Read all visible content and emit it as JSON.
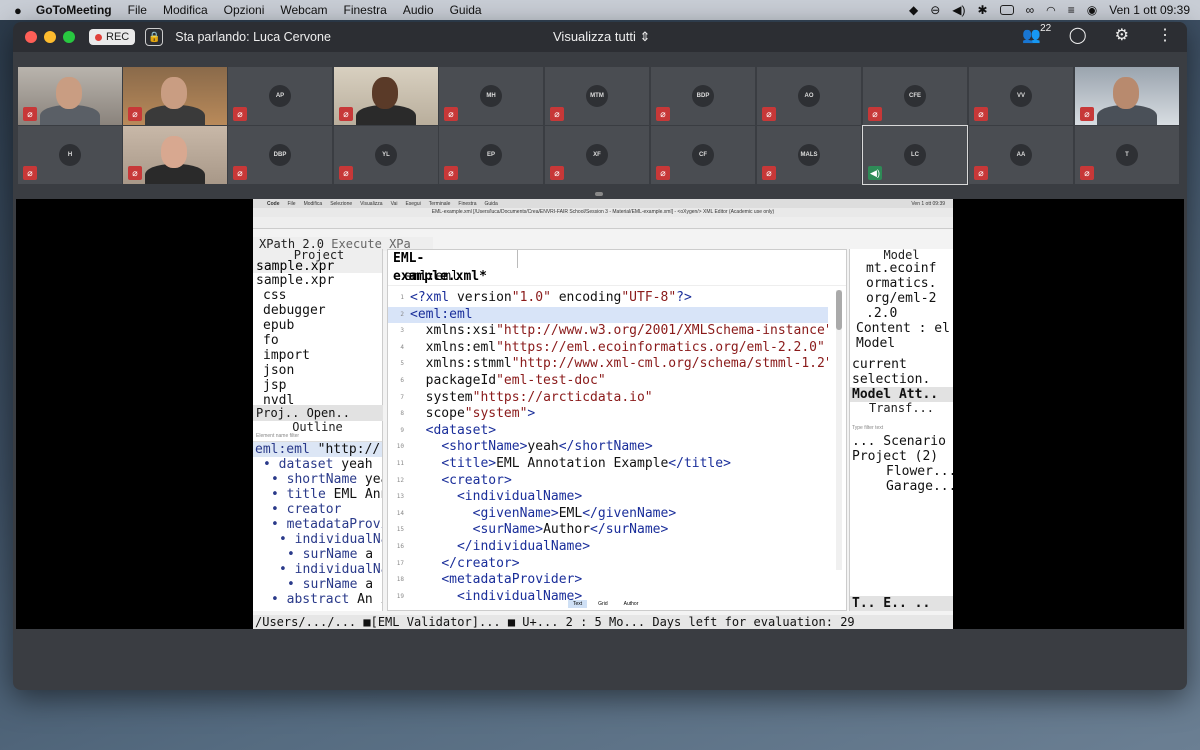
{
  "menubar": {
    "apple": "",
    "app_name": "GoToMeeting",
    "items": [
      "File",
      "Modifica",
      "Opzioni",
      "Webcam",
      "Finestra",
      "Audio",
      "Guida"
    ],
    "clock": "Ven 1 ott  09:39"
  },
  "titlebar": {
    "rec_label": "REC",
    "speaking_label": "Sta parlando: Luca Cervone",
    "view_all_label": "Visualizza tutti",
    "participant_count": "22",
    "colors": {
      "close": "#ff5f57",
      "minimize": "#febc2e",
      "maximize": "#28c840"
    }
  },
  "participants": {
    "row1": [
      "",
      "",
      "AP",
      "",
      "MH",
      "MTM",
      "BDP",
      "AO",
      "CFE",
      "VV",
      ""
    ],
    "row2": [
      "H",
      "",
      "DBP",
      "YL",
      "EP",
      "XF",
      "CF",
      "MALS",
      "LC",
      "AA",
      "T"
    ]
  },
  "shared_screen": {
    "inner_menubar": [
      "Code",
      "File",
      "Modifica",
      "Selezione",
      "Visualizza",
      "Vai",
      "Esegui",
      "Terminale",
      "Finestra",
      "Guida"
    ],
    "inner_clock": "Ven 1 ott  09:39",
    "window_title": "EML-example.xml [/Users/luca/Documents/Crea/ENVRI-FAIR School/Session 3 - Material/EML-example.xml] - <oXygen/> XML Editor (Academic use only)",
    "xpath_label": "XPath 2.0",
    "xpath_extra": "Execute XPa",
    "project": {
      "title": "Project",
      "file": "sample.xpr",
      "root": "sample.xpr",
      "folders": [
        "css",
        "debugger",
        "epub",
        "fo",
        "import",
        "json",
        "jsp",
        "nvdl"
      ]
    },
    "left_tabs": "Proj..  Open..",
    "outline": {
      "title": "Outline",
      "filter_placeholder": "Element name filter",
      "items": [
        {
          "indent": 0,
          "name": "eml:eml",
          "val": "\"http://"
        },
        {
          "indent": 1,
          "name": "dataset",
          "val": "yeah"
        },
        {
          "indent": 2,
          "name": "shortName",
          "val": "yea"
        },
        {
          "indent": 2,
          "name": "title",
          "val": "EML Ann"
        },
        {
          "indent": 2,
          "name": "creator",
          "val": ""
        },
        {
          "indent": 2,
          "name": "metadataProvi",
          "val": ""
        },
        {
          "indent": 3,
          "name": "individualNa",
          "val": ""
        },
        {
          "indent": 4,
          "name": "surName",
          "val": "a"
        },
        {
          "indent": 3,
          "name": "individualNa",
          "val": ""
        },
        {
          "indent": 4,
          "name": "surName",
          "val": "a"
        },
        {
          "indent": 2,
          "name": "abstract",
          "val": "An i"
        }
      ]
    },
    "editor": {
      "tab": "EML-example.xml*",
      "breadcrumb": "eml:eml",
      "lines": [
        {
          "n": "1",
          "t": "<?xml version=\"1.0\" encoding=\"UTF-8\"?>"
        },
        {
          "n": "2",
          "t": "<eml:eml"
        },
        {
          "n": "3",
          "t": "  xmlns:xsi=\"http://www.w3.org/2001/XMLSchema-instance\""
        },
        {
          "n": "4",
          "t": "  xmlns:eml=\"https://eml.ecoinformatics.org/eml-2.2.0\""
        },
        {
          "n": "5",
          "t": "  xmlns:stmml=\"http://www.xml-cml.org/schema/stmml-1.2\""
        },
        {
          "n": "6",
          "t": "  packageId=\"eml-test-doc\""
        },
        {
          "n": "7",
          "t": "  system=\"https://arcticdata.io\""
        },
        {
          "n": "8",
          "t": "  scope=\"system\">"
        },
        {
          "n": "9",
          "t": "  <dataset>"
        },
        {
          "n": "10",
          "t": "    <shortName>yeah</shortName>"
        },
        {
          "n": "11",
          "t": "    <title>EML Annotation Example</title>"
        },
        {
          "n": "12",
          "t": "    <creator>"
        },
        {
          "n": "13",
          "t": "      <individualName>"
        },
        {
          "n": "14",
          "t": "        <givenName>EML</givenName>"
        },
        {
          "n": "15",
          "t": "        <surName>Author</surName>"
        },
        {
          "n": "16",
          "t": "      </individualName>"
        },
        {
          "n": "17",
          "t": "    </creator>"
        },
        {
          "n": "18",
          "t": "    <metadataProvider>"
        },
        {
          "n": "19",
          "t": "      <individualName>"
        }
      ],
      "bottom_tabs": [
        "Text",
        "Grid",
        "Author"
      ]
    },
    "right_pane": {
      "model_title": "Model",
      "model_lines": [
        "mt.ecoinf",
        "ormatics.",
        "org/eml-2",
        ".2.0",
        "Content : el",
        "Model"
      ],
      "selection_lines": [
        "current",
        "selection."
      ],
      "tabs1": "Model  Att..",
      "transform_title": "Transf...",
      "filter_placeholder": "Type filter text",
      "scenario_header": "... Scenario",
      "project_label": "Project (2)",
      "scenarios": [
        "Flower...",
        "Garage..."
      ],
      "tabs2": "T..  E..  .."
    },
    "status_bar": "/Users/.../...  ■[EML Validator]...  ■ U+...  2 : 5  Mo...  Days left for evaluation: 29"
  }
}
